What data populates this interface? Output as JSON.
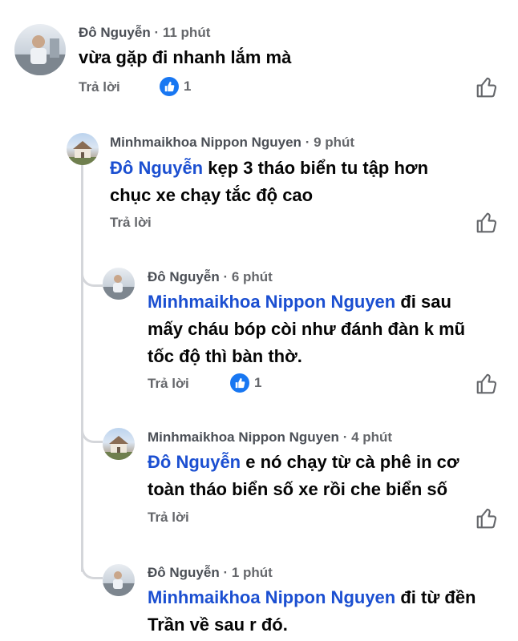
{
  "comments": [
    {
      "author": "Đô Nguyễn",
      "time": "· 11 phút",
      "text": "vừa gặp đi nhanh lắm mà",
      "reply_label": "Trả lời",
      "reaction_count": "1",
      "avatar": "person-avatar"
    },
    {
      "author": "Minhmaikhoa Nippon Nguyen",
      "time": "· 9 phút",
      "mention": "Đô Nguyễn",
      "text_line1": " kẹp 3  tháo biển tu tập hơn",
      "text_line2": "chục xe chạy tắc độ cao",
      "reply_label": "Trả lời",
      "avatar": "house-avatar"
    },
    {
      "author": "Đô Nguyễn",
      "time": "· 6 phút",
      "mention": "Minhmaikhoa Nippon Nguyen",
      "text_line1": " đi sau",
      "text_line2": "mấy cháu bóp còi như đánh đàn k mũ",
      "text_line3": "tốc độ thì bàn thờ.",
      "reply_label": "Trả lời",
      "reaction_count": "1",
      "avatar": "person-avatar"
    },
    {
      "author": "Minhmaikhoa Nippon Nguyen",
      "time": "· 4 phút",
      "mention": "Đô Nguyễn",
      "text_line1": "  e nó chạy từ cà phê in cơ",
      "text_line2": "toàn tháo biển số xe rồi che biển số",
      "reply_label": "Trả lời",
      "avatar": "house-avatar"
    },
    {
      "author": "Đô Nguyễn",
      "time": "· 1 phút",
      "mention": "Minhmaikhoa Nippon Nguyen",
      "text_line1": " đi từ đền",
      "text_line2": "Trần về sau r đó.",
      "avatar": "person-avatar"
    }
  ],
  "colors": {
    "mention": "#1b4fd1",
    "like_blue": "#1877f2",
    "secondary_text": "#65676b",
    "thread_line": "#d4d6da"
  },
  "icons": [
    "thumbs-up-outline-icon",
    "like-reaction-icon"
  ]
}
